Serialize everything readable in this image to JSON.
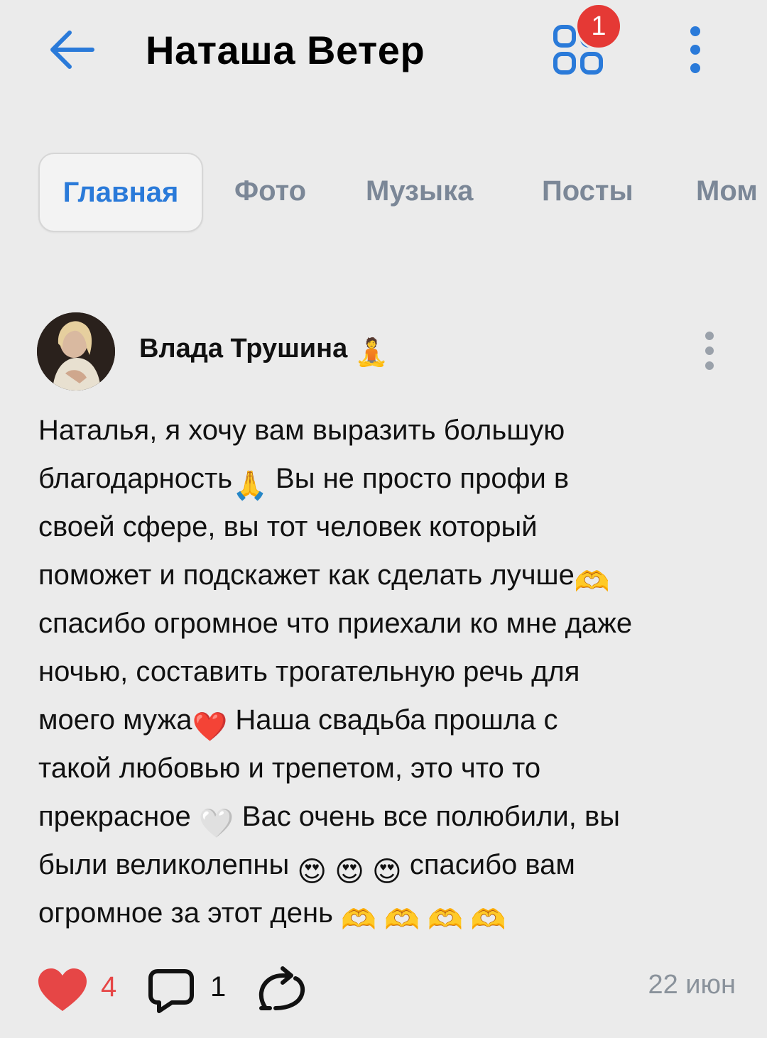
{
  "header": {
    "title": "Наташа Ветер",
    "back_icon": "arrow-left-icon",
    "apps_icon": "apps-grid-icon",
    "notification_badge": "1",
    "more_icon": "more-vertical-icon"
  },
  "tabs": [
    {
      "label": "Главная",
      "active": true
    },
    {
      "label": "Фото"
    },
    {
      "label": "Музыка"
    },
    {
      "label": "Посты"
    },
    {
      "label": "Мом"
    }
  ],
  "post": {
    "author": "Влада Трушина",
    "author_emoji": "🧘",
    "lines": [
      [
        "Наталья, я хочу вам выразить большую"
      ],
      [
        "благодарность",
        "🙏",
        " Вы не просто профи в"
      ],
      [
        "своей сфере, вы тот человек который"
      ],
      [
        "поможет и подскажет как сделать лучше",
        "🫶"
      ],
      [
        "спасибо огромное что приехали ко мне даже"
      ],
      [
        "ночью, составить трогательную речь для"
      ],
      [
        "моего мужа",
        "❤️",
        " Наша свадьба прошла с"
      ],
      [
        "такой любовью и трепетом, это что то"
      ],
      [
        "прекрасное ",
        "🤍",
        " Вас очень все полюбили, вы"
      ],
      [
        "были великолепны ",
        "😍",
        " ",
        "😍",
        " ",
        "😍",
        " спасибо вам"
      ],
      [
        "огромное за этот день ",
        "🫶",
        " ",
        "🫶",
        " ",
        "🫶",
        " ",
        "🫶"
      ]
    ],
    "likes": "4",
    "comments": "1",
    "date": "22 июн"
  },
  "colors": {
    "accent": "#2a7ad9",
    "like": "#e64646",
    "background": "#ebebeb"
  }
}
